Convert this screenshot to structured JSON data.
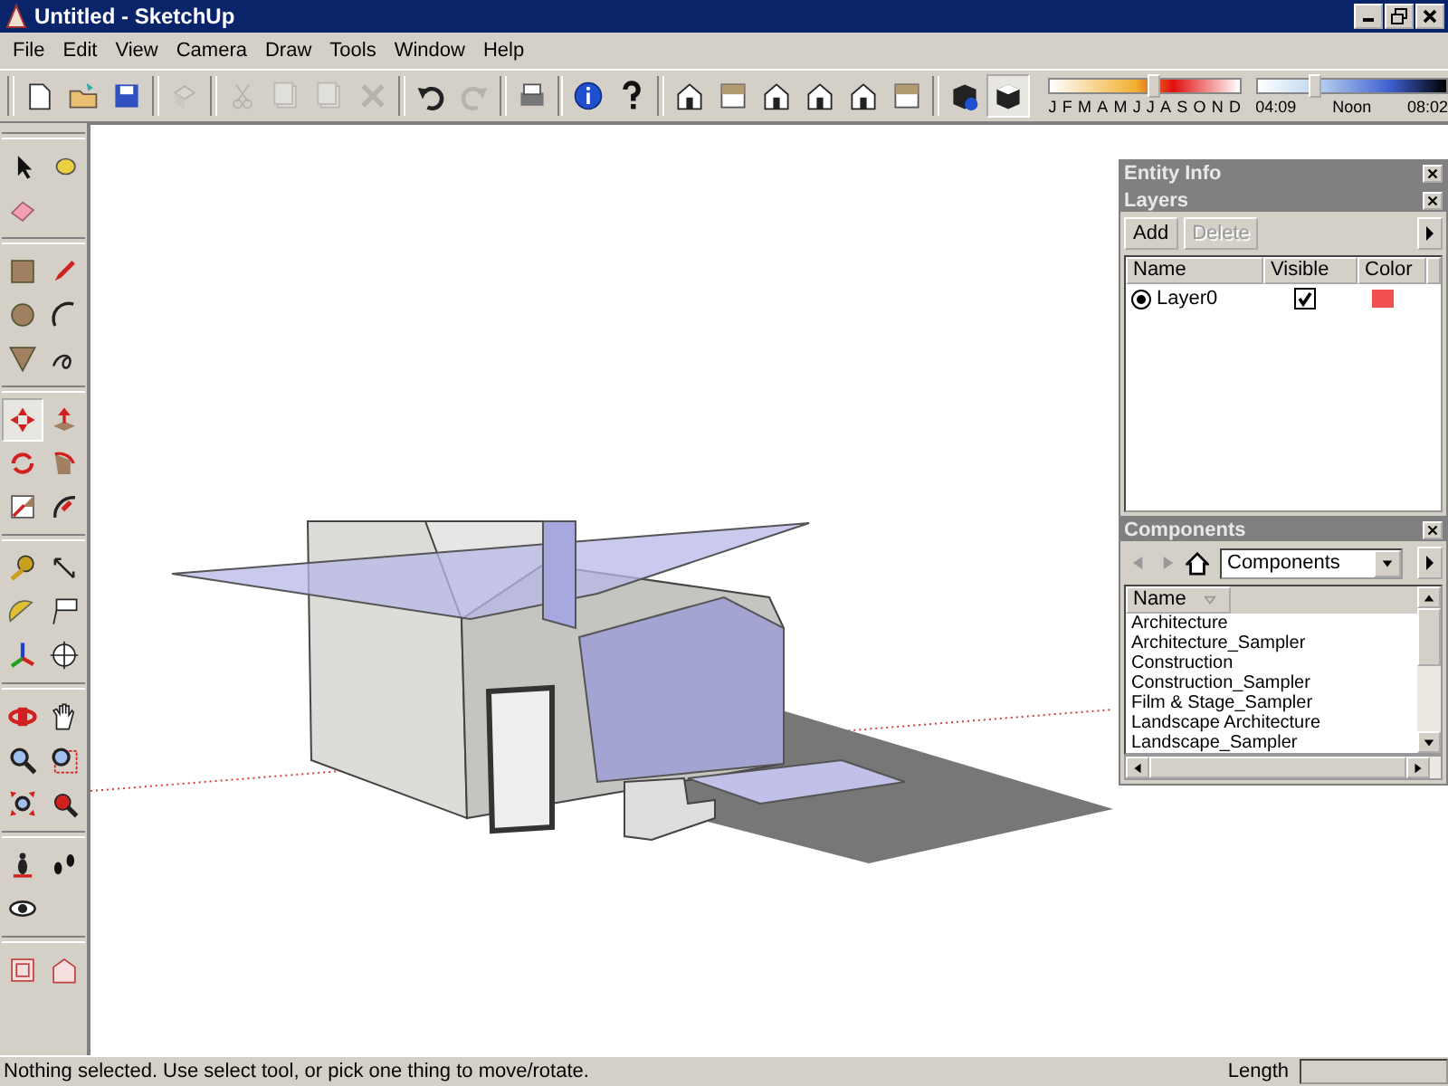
{
  "window": {
    "title": "Untitled - SketchUp"
  },
  "menu": [
    "File",
    "Edit",
    "View",
    "Camera",
    "Draw",
    "Tools",
    "Window",
    "Help"
  ],
  "toolbar_buttons": [
    {
      "disabled": false,
      "selected": false
    },
    {
      "disabled": false,
      "selected": false
    },
    {
      "disabled": false,
      "selected": false
    },
    {
      "disabled": true,
      "selected": false
    },
    {
      "disabled": true,
      "selected": false
    },
    {
      "disabled": true,
      "selected": false
    },
    {
      "disabled": true,
      "selected": false
    },
    {
      "disabled": true,
      "selected": false
    },
    {
      "disabled": false,
      "selected": false
    },
    {
      "disabled": true,
      "selected": false
    },
    {
      "disabled": false,
      "selected": false
    },
    {
      "disabled": false,
      "selected": false
    },
    {
      "disabled": false,
      "selected": false
    },
    {
      "disabled": false,
      "selected": false
    },
    {
      "disabled": false,
      "selected": false
    },
    {
      "disabled": false,
      "selected": false
    },
    {
      "disabled": false,
      "selected": false
    },
    {
      "disabled": false,
      "selected": false
    },
    {
      "disabled": false,
      "selected": false
    },
    {
      "disabled": false,
      "selected": false
    },
    {
      "disabled": false,
      "selected": true
    }
  ],
  "shadow_settings": {
    "month_slider": {
      "level": 0.54,
      "labels": [
        "J",
        "F",
        "M",
        "A",
        "M",
        "J",
        "J",
        "A",
        "S",
        "O",
        "N",
        "D"
      ]
    },
    "time_slider": {
      "level": 0.3,
      "start": "04:09",
      "middle": "Noon",
      "end": "08:02"
    }
  },
  "tools": [
    {
      "selected": false
    },
    {
      "selected": false
    },
    {
      "selected": false
    },
    {
      "selected": false
    },
    {
      "selected": false
    },
    {
      "selected": false
    },
    {
      "selected": false
    },
    {
      "selected": false
    },
    {
      "selected": false
    },
    {
      "selected": true
    },
    {
      "selected": false
    },
    {
      "selected": false
    },
    {
      "selected": false
    },
    {
      "selected": false
    },
    {
      "selected": false
    },
    {
      "selected": false
    },
    {
      "selected": false
    },
    {
      "selected": false
    },
    {
      "selected": false
    },
    {
      "selected": false
    },
    {
      "selected": false
    },
    {
      "selected": false
    },
    {
      "selected": false
    },
    {
      "selected": false
    },
    {
      "selected": false
    },
    {
      "selected": false
    },
    {
      "selected": false
    },
    {
      "selected": false
    },
    {
      "selected": false
    },
    {
      "selected": false
    },
    {
      "selected": false
    },
    {
      "selected": false
    }
  ],
  "entity_info": {
    "title": "Entity Info"
  },
  "layers": {
    "title": "Layers",
    "buttons": [
      {
        "label": "Add",
        "disabled": false
      },
      {
        "label": "Delete",
        "disabled": true
      }
    ],
    "columns": [
      "Name",
      "Visible",
      "Color"
    ],
    "rows": [
      {
        "name": "Layer0",
        "selected": true,
        "visible": true,
        "color": "#f05050"
      }
    ]
  },
  "components": {
    "title": "Components",
    "dropdown": "Components",
    "column": "Name",
    "items": [
      "Architecture",
      "Architecture_Sampler",
      "Construction",
      "Construction_Sampler",
      "Film & Stage_Sampler",
      "Landscape Architecture",
      "Landscape_Sampler"
    ]
  },
  "status_bar": {
    "message": "Nothing selected. Use select tool, or pick one thing to move/rotate.",
    "measurement_label": "Length"
  }
}
